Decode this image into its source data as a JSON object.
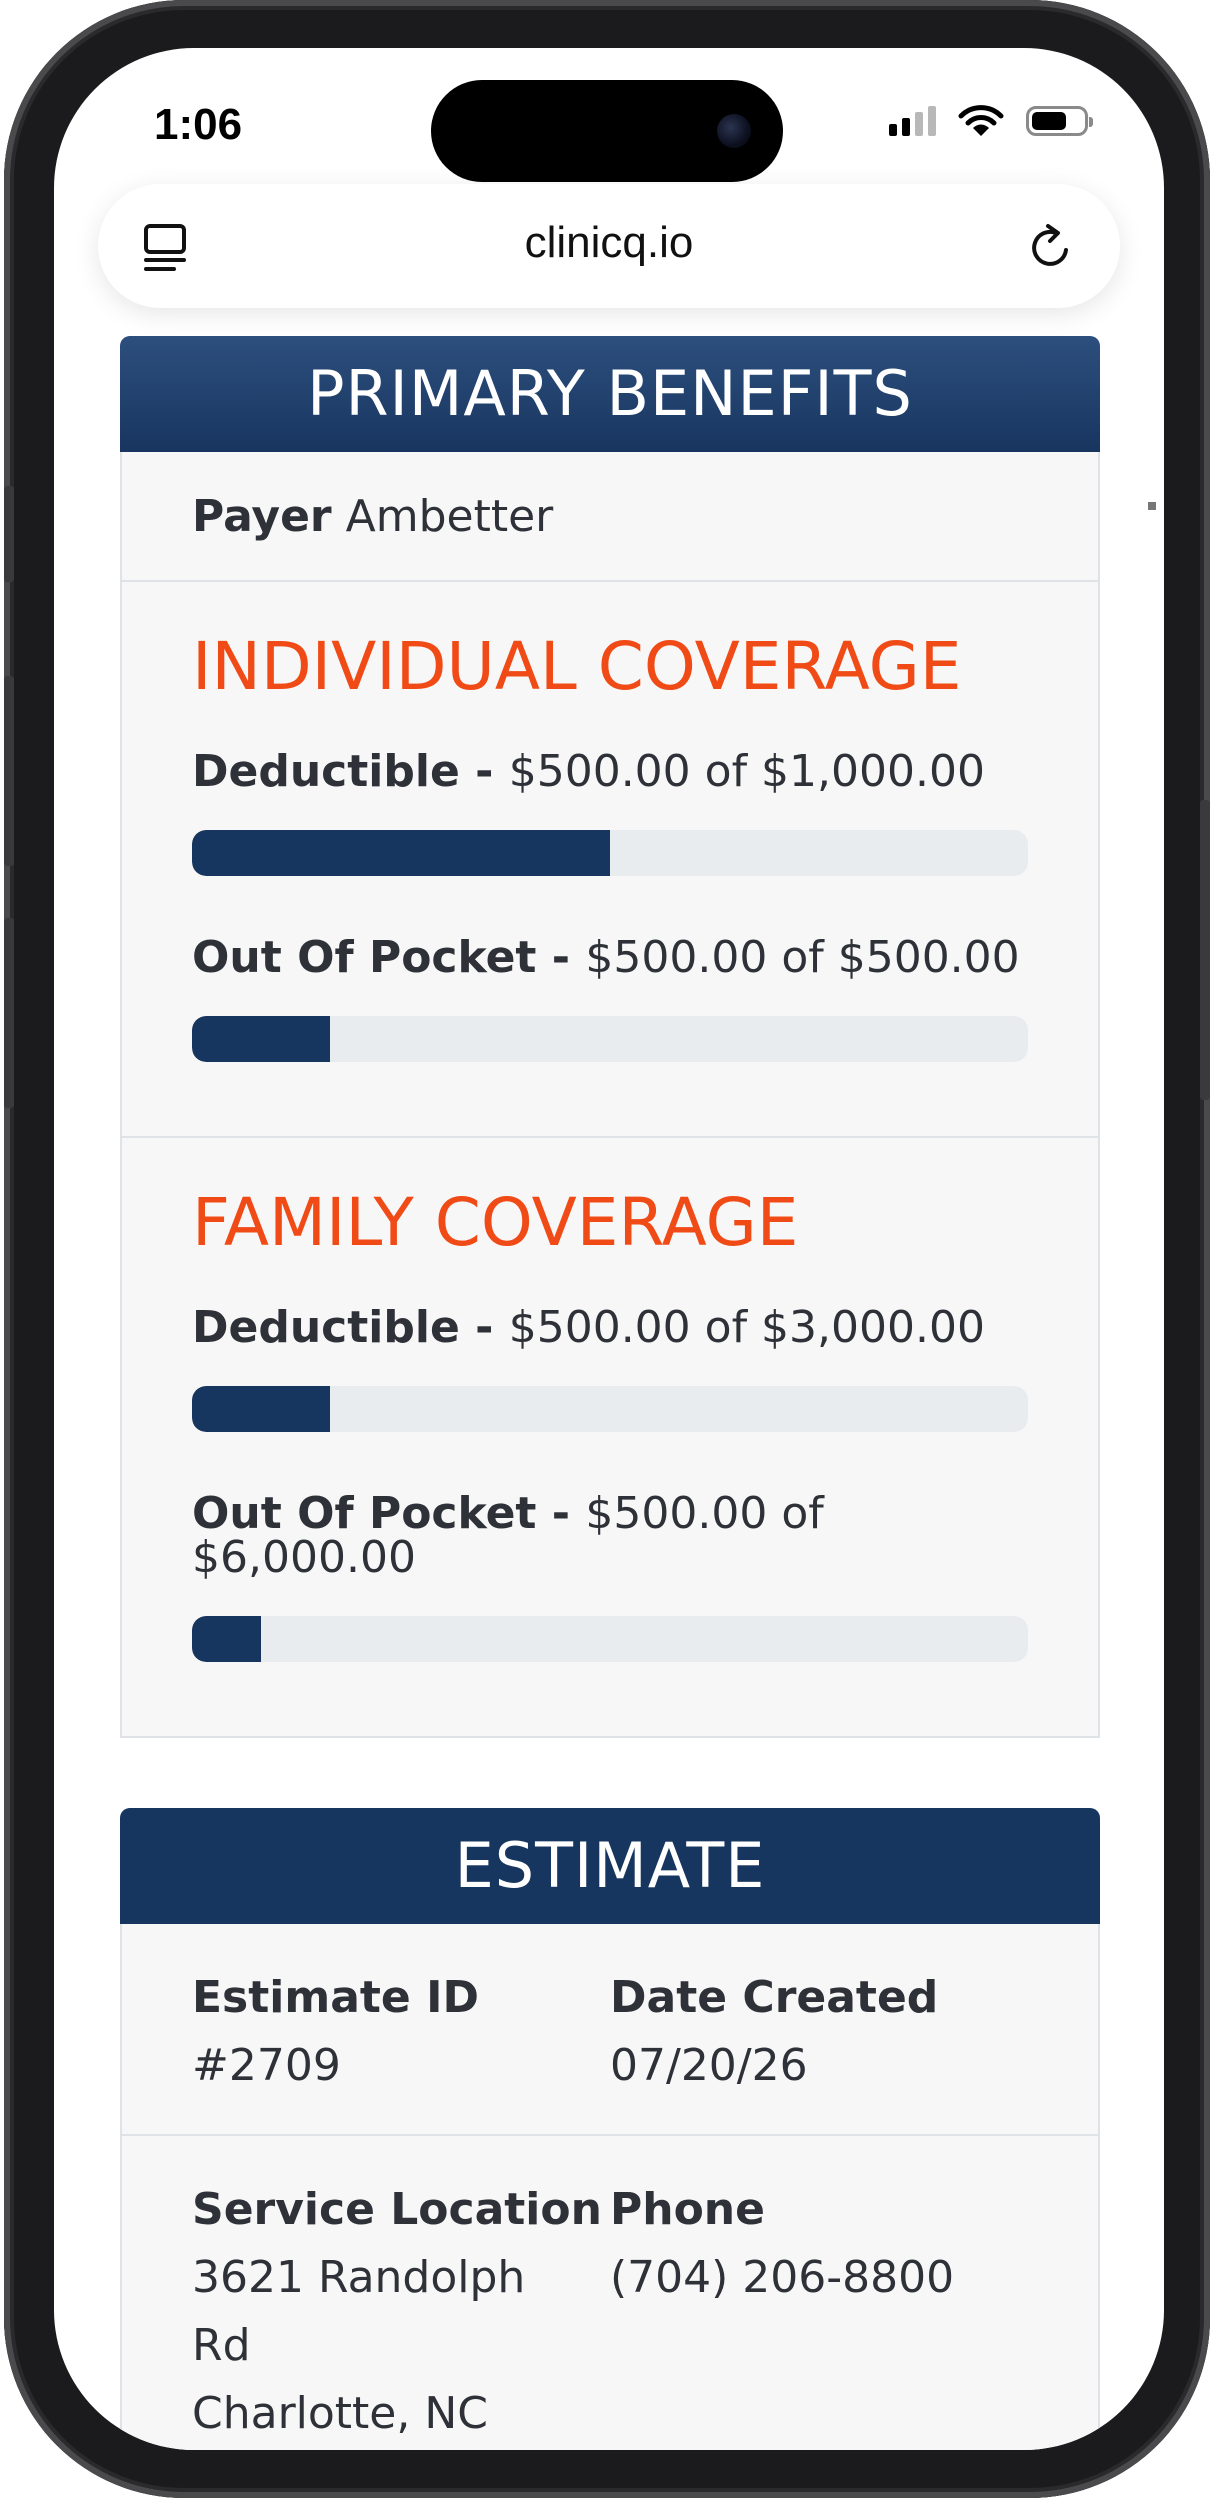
{
  "status_bar": {
    "time": "1:06"
  },
  "browser": {
    "url": "clinicq.io"
  },
  "primary_benefits": {
    "header": "PRIMARY BENEFITS",
    "payer_label": "Payer",
    "payer_value": "Ambetter",
    "individual": {
      "title": "INDIVIDUAL COVERAGE",
      "deductible": {
        "label": "Deductible",
        "sep": " - ",
        "amount": "$500.00 of $1,000.00",
        "progress_percent": 50
      },
      "out_of_pocket": {
        "label": "Out Of Pocket",
        "sep": " - ",
        "amount": "$500.00 of $500.00",
        "progress_percent": 16.5
      }
    },
    "family": {
      "title": "FAMILY COVERAGE",
      "deductible": {
        "label": "Deductible",
        "sep": " - ",
        "amount": "$500.00 of $3,000.00",
        "progress_percent": 16.5
      },
      "out_of_pocket": {
        "label": "Out Of Pocket",
        "sep": " - ",
        "amount": "$500.00 of $6,000.00",
        "progress_percent": 8.3
      }
    }
  },
  "estimate": {
    "header": "ESTIMATE",
    "estimate_id_label": "Estimate ID",
    "estimate_id_value": "#2709",
    "date_created_label": "Date Created",
    "date_created_value": "07/20/26",
    "service_location_label": "Service Location",
    "service_location_line1": "3621 Randolph",
    "service_location_line2": "Rd",
    "service_location_line3": "Charlotte, NC",
    "phone_label": "Phone",
    "phone_value": "(704) 206-8800"
  },
  "colors": {
    "header_navy": "#17365f",
    "coverage_orange": "#f04b16",
    "bar_track": "#e9ecef",
    "card_bg": "#f7f7f7"
  },
  "icons": [
    "tabs-icon",
    "reload-icon",
    "cellular-signal-icon",
    "wifi-icon",
    "battery-icon"
  ]
}
